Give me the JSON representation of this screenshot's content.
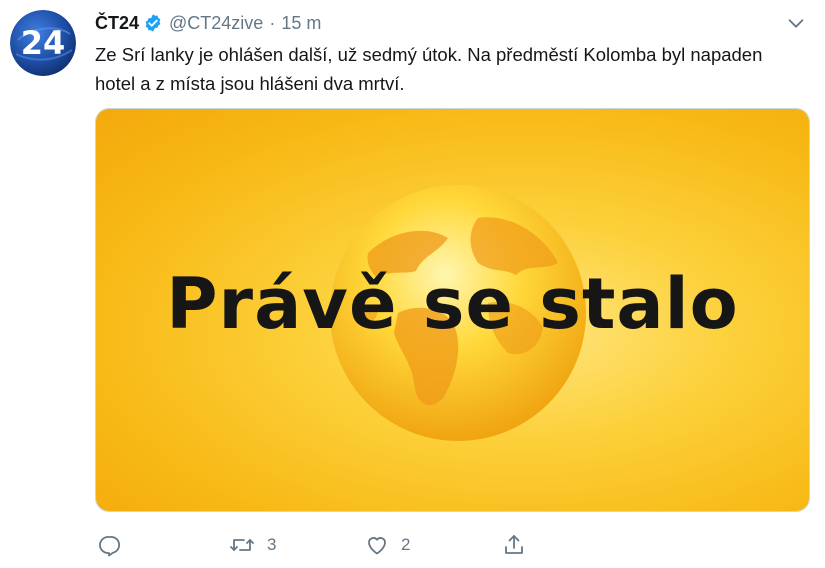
{
  "account": {
    "display_name": "ČT24",
    "handle": "@CT24zive",
    "separator": "·",
    "timestamp": "15 m",
    "avatar_text": "24",
    "verified": true
  },
  "tweet": {
    "text": "Ze Srí lanky je ohlášen další, už sedmý útok. Na předměstí Kolomba byl napaden hotel a z místa jsou hlášeni dva mrtví."
  },
  "media": {
    "caption": "Právě se stalo",
    "icon": "globe"
  },
  "actions": {
    "reply": {
      "icon": "reply-icon",
      "count": ""
    },
    "retweet": {
      "icon": "retweet-icon",
      "count": "3"
    },
    "like": {
      "icon": "heart-icon",
      "count": "2"
    },
    "share": {
      "icon": "share-icon",
      "count": ""
    }
  },
  "colors": {
    "verified": "#1da1f2",
    "muted": "#657786",
    "text": "#14171a",
    "media_yellow": "#f7b712",
    "avatar_blue": "#1f4fa6"
  }
}
